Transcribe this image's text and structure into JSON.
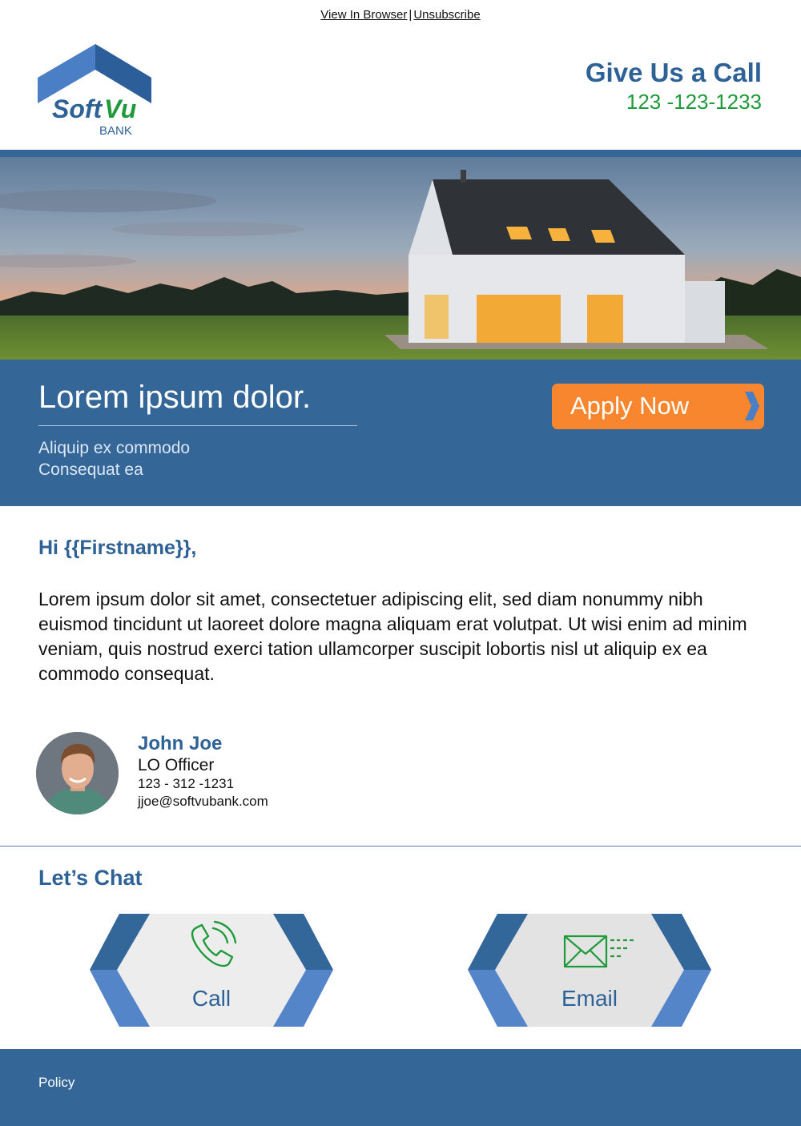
{
  "top_links": {
    "view_in_browser": "View In Browser",
    "separator": "|",
    "unsubscribe": "Unsubscribe"
  },
  "logo": {
    "brand_part1": "Soft",
    "brand_part2": "Vu",
    "brand_sub": "BANK"
  },
  "header": {
    "call_title": "Give Us a Call",
    "call_number": "123 -123-1233"
  },
  "banner": {
    "title": "Lorem ipsum dolor.",
    "subtitle_line1": "Aliquip ex commodo",
    "subtitle_line2": "Consequat ea",
    "cta_label": "Apply Now",
    "cta_icon": "chevron-right-icon"
  },
  "content": {
    "greeting": "Hi {{Firstname}},",
    "body": "Lorem ipsum dolor sit amet, consectetuer adipiscing elit, sed diam nonummy nibh euismod tincidunt ut laoreet dolore magna aliquam erat volutpat. Ut wisi enim ad minim veniam, quis nostrud exerci tation ullamcorper suscipit lobortis nisl ut aliquip ex ea commodo consequat."
  },
  "signature": {
    "name": "John Joe",
    "title": "LO Officer",
    "phone": "123 - 312 -1231",
    "email": "jjoe@softvubank.com"
  },
  "chat": {
    "title": "Let’s Chat",
    "call_label": "Call",
    "call_icon": "phone-icon",
    "email_label": "Email",
    "email_icon": "envelope-icon"
  },
  "footer": {
    "policy": "Policy"
  },
  "colors": {
    "primary_blue": "#356698",
    "accent_orange": "#f7862f",
    "accent_green": "#1f9a3a",
    "light_blue": "#5585c9"
  }
}
